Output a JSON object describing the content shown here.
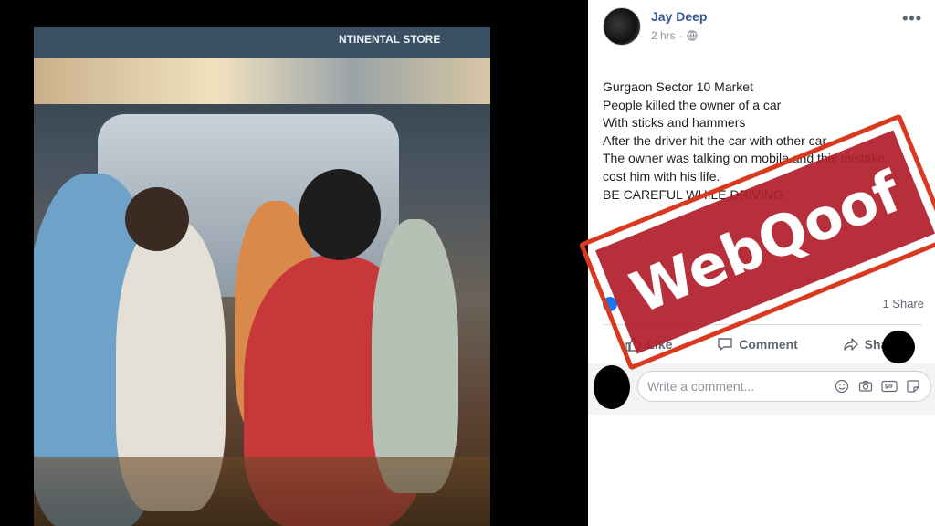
{
  "media": {
    "sign_text": "NTINENTAL STORE"
  },
  "post": {
    "author": "Jay Deep",
    "time": "2 hrs",
    "more_label": "•••",
    "lines": [
      "Gurgaon Sector 10 Market",
      "People killed the owner of a car",
      "With sticks and hammers",
      "After the driver hit the car with other car.",
      "The owner was talking on mobile and this mistake",
      "cost him with his life.",
      "BE CAREFUL WHILE DRIVING"
    ],
    "shares": "1 Share",
    "actions": {
      "like": "Like",
      "comment": "Comment",
      "share": "Share"
    },
    "comment_placeholder": "Write a comment..."
  },
  "stamp": {
    "text": "WebQoof"
  },
  "colors": {
    "link": "#385898",
    "stamp_red": "#b01e2a",
    "stamp_border": "#d8391f"
  },
  "icons": [
    "globe-icon",
    "like-icon",
    "comment-icon",
    "share-icon",
    "emoji-icon",
    "camera-icon",
    "gif-icon",
    "sticker-icon"
  ]
}
